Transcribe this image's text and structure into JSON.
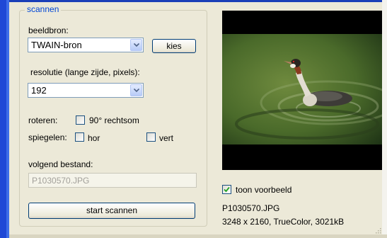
{
  "group": {
    "caption": "scannen"
  },
  "source": {
    "label": "beeldbron:",
    "value": "TWAIN-bron",
    "choose_label": "kies"
  },
  "resolution": {
    "label": "resolutie (lange zijde, pixels):",
    "value": "192"
  },
  "rotate": {
    "label": "roteren:",
    "option": "90° rechtsom",
    "checked": false
  },
  "mirror": {
    "label": "spiegelen:",
    "horizontal": {
      "label": "hor",
      "checked": false
    },
    "vertical": {
      "label": "vert",
      "checked": false
    }
  },
  "next_file": {
    "label": "volgend bestand:",
    "value": "P1030570.JPG"
  },
  "scan_button": {
    "label": "start scannen"
  },
  "preview": {
    "show_label": "toon voorbeeld",
    "show_checked": true,
    "filename": "P1030570.JPG",
    "info": "3248 x 2160, TrueColor, 3021kB"
  },
  "colors": {
    "window_border": "#1f48d6",
    "caption": "#0046d5",
    "dialog_bg": "#ece9d8",
    "check_mark": "#21a121"
  }
}
